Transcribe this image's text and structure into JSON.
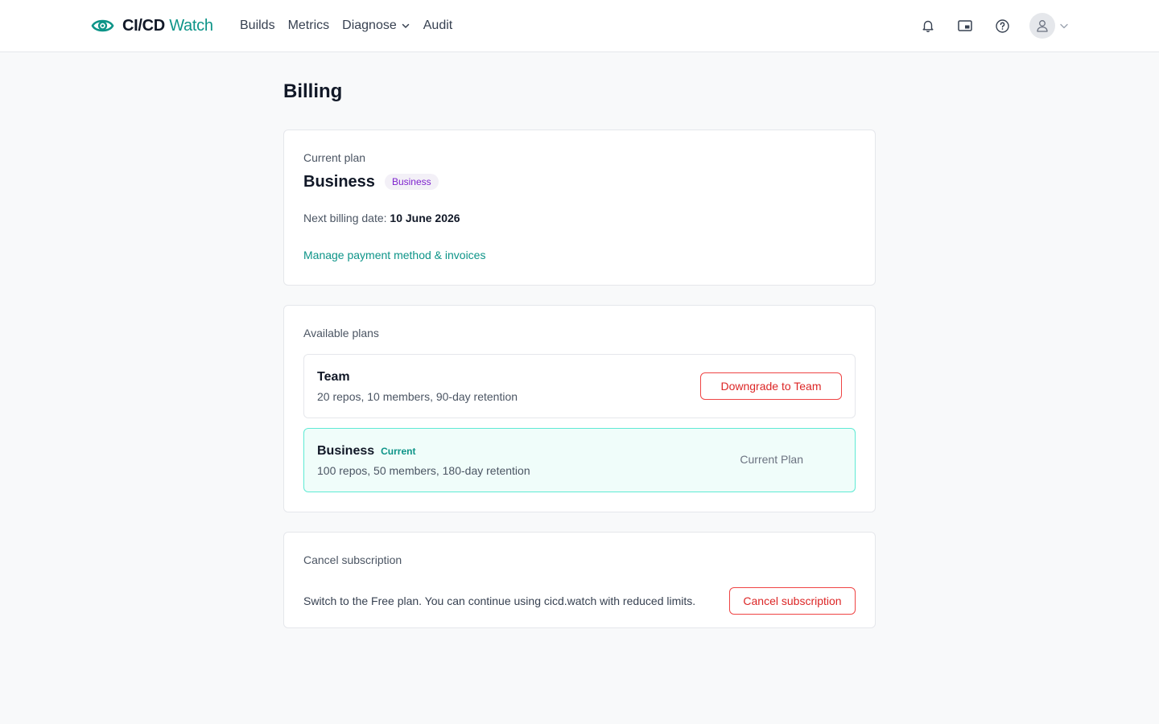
{
  "app": {
    "logo_bold": "CI/CD",
    "logo_light": "Watch"
  },
  "nav": {
    "items": [
      {
        "label": "Builds"
      },
      {
        "label": "Metrics"
      },
      {
        "label": "Diagnose",
        "has_dropdown": true
      },
      {
        "label": "Audit"
      }
    ]
  },
  "header_icons": [
    "bell-icon",
    "picture-in-picture-icon",
    "help-circle-icon",
    "user-icon",
    "chevron-down-icon"
  ],
  "page": {
    "title": "Billing"
  },
  "current_plan": {
    "label": "Current plan",
    "name": "Business",
    "badge": "Business",
    "billing_label": "Next billing date:",
    "billing_date": "10 June 2026",
    "manage_link": "Manage payment method & invoices"
  },
  "available_plans": {
    "label": "Available plans",
    "plans": [
      {
        "name": "Team",
        "description": "20 repos, 10 members, 90-day retention",
        "action_label": "Downgrade to Team",
        "is_current": false
      },
      {
        "name": "Business",
        "current_tag": "Current",
        "description": "100 repos, 50 members, 180-day retention",
        "action_label": "Current Plan",
        "is_current": true
      }
    ]
  },
  "cancel": {
    "label": "Cancel subscription",
    "description": "Switch to the Free plan. You can continue using cicd.watch with reduced limits.",
    "button_label": "Cancel subscription"
  },
  "colors": {
    "accent": "#0d9488",
    "danger": "#dc2626",
    "badge_purple": "#7e22ce",
    "current_bg": "#f0fdfa",
    "current_border": "#5eead4"
  }
}
